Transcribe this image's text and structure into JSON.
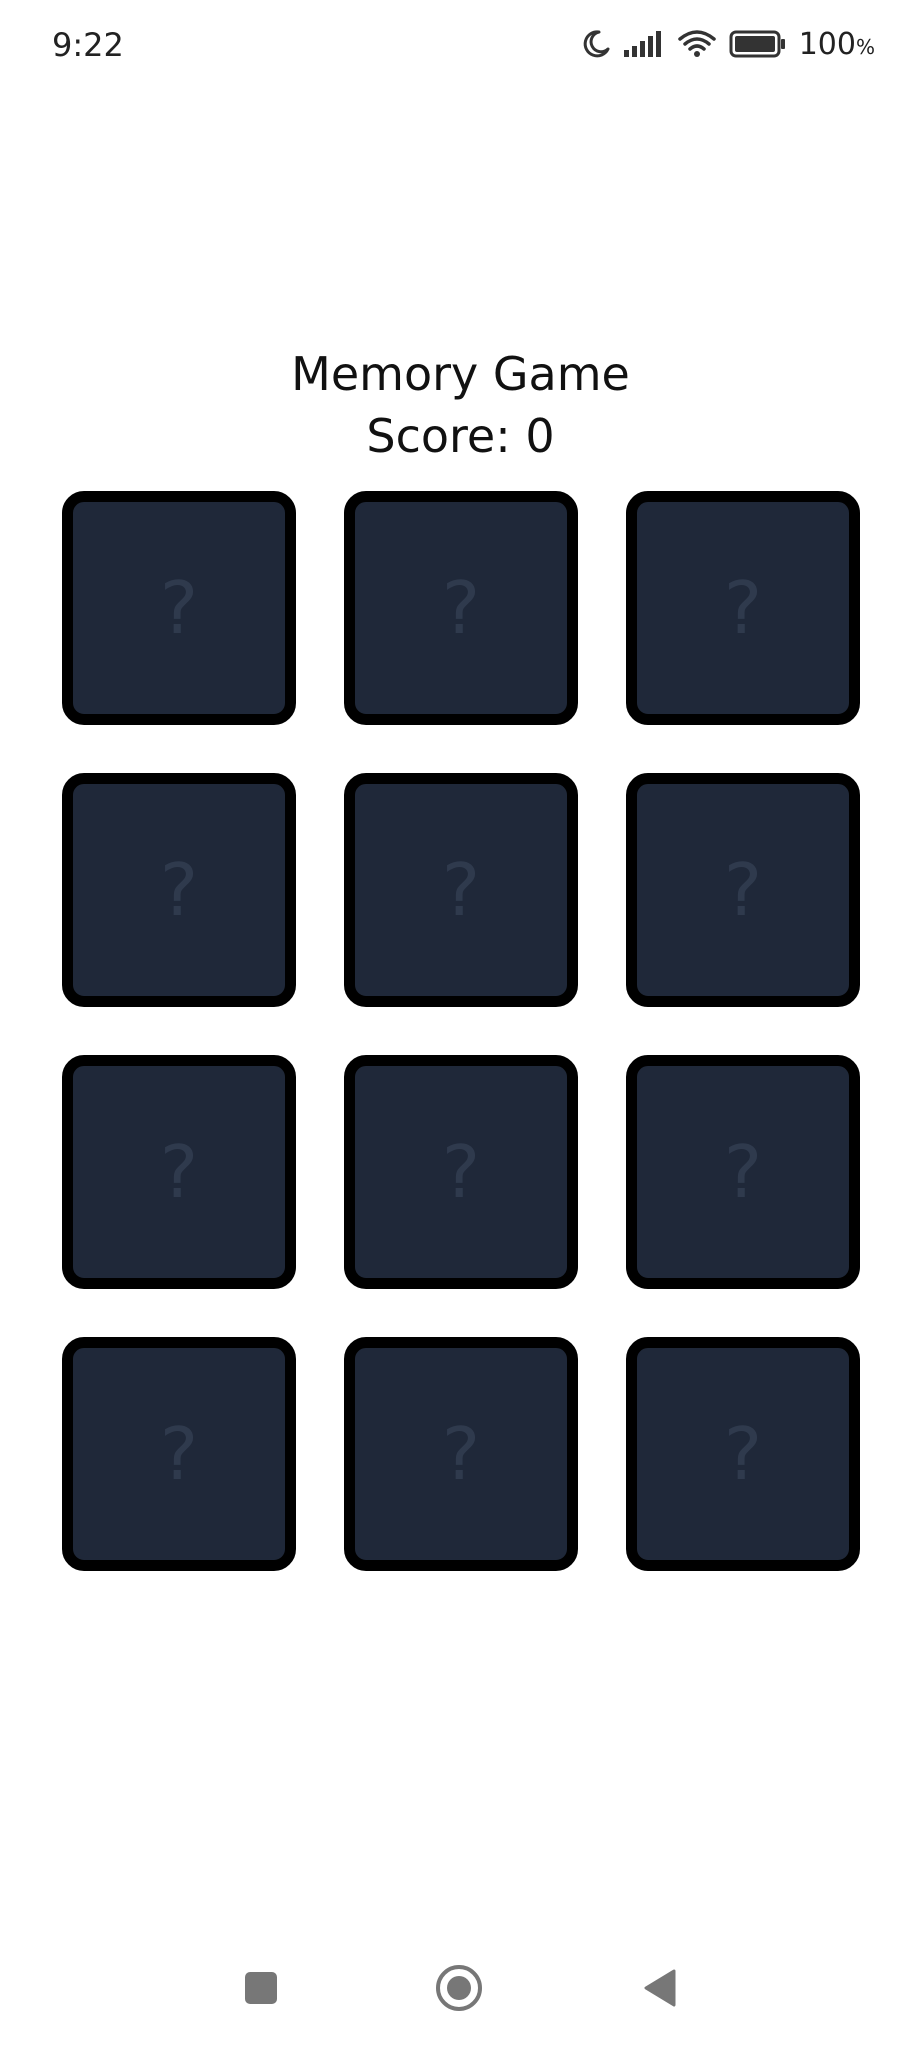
{
  "status_bar": {
    "time": "9:22",
    "battery_percent": "100",
    "battery_unit": "%",
    "icons": [
      "moon-icon",
      "signal-icon",
      "wifi-icon",
      "battery-icon"
    ]
  },
  "game": {
    "title": "Memory Game",
    "score_text": "Score: 0",
    "card_color": "#1f2839",
    "card_border_color": "#000000",
    "cards": [
      {
        "face": "?"
      },
      {
        "face": "?"
      },
      {
        "face": "?"
      },
      {
        "face": "?"
      },
      {
        "face": "?"
      },
      {
        "face": "?"
      },
      {
        "face": "?"
      },
      {
        "face": "?"
      },
      {
        "face": "?"
      },
      {
        "face": "?"
      },
      {
        "face": "?"
      },
      {
        "face": "?"
      }
    ]
  },
  "nav_bar": {
    "buttons": [
      "recent-apps-icon",
      "home-icon",
      "back-icon"
    ]
  }
}
